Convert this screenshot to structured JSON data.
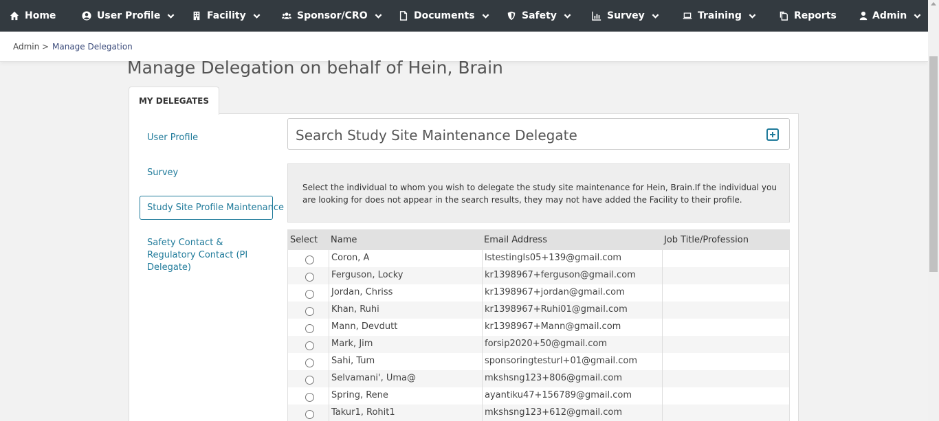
{
  "nav": {
    "home": "Home",
    "user_profile": "User Profile",
    "facility": "Facility",
    "sponsor_cro": "Sponsor/CRO",
    "documents": "Documents",
    "safety": "Safety",
    "survey": "Survey",
    "training": "Training",
    "reports": "Reports",
    "admin": "Admin"
  },
  "breadcrumb": {
    "root": "Admin",
    "separator": ">",
    "current": "Manage Delegation"
  },
  "page": {
    "title": "Manage Delegation on behalf of Hein, Brain",
    "tab": "MY DELEGATES"
  },
  "sidebar": {
    "items": [
      {
        "label": "User Profile"
      },
      {
        "label": "Survey"
      },
      {
        "label": "Study Site Profile Maintenance"
      },
      {
        "label": "Safety Contact & Regulatory Contact (PI Delegate)"
      }
    ]
  },
  "search": {
    "title": "Search Study Site Maintenance Delegate"
  },
  "info": {
    "text": "Select the individual to whom you wish to delegate the study site maintenance for Hein, Brain.If the individual you are looking for does not appear in the search results, they may not have added the Facility to their profile."
  },
  "table": {
    "headers": {
      "select": "Select",
      "name": "Name",
      "email": "Email Address",
      "job": "Job Title/Profession"
    },
    "rows": [
      {
        "name": "Coron, A",
        "email": "lstestingls05+139@gmail.com",
        "job": ""
      },
      {
        "name": "Ferguson, Locky",
        "email": "kr1398967+ferguson@gmail.com",
        "job": ""
      },
      {
        "name": "Jordan, Chriss",
        "email": "kr1398967+jordan@gmail.com",
        "job": ""
      },
      {
        "name": "Khan, Ruhi",
        "email": "kr1398967+Ruhi01@gmail.com",
        "job": ""
      },
      {
        "name": "Mann, Devdutt",
        "email": "kr1398967+Mann@gmail.com",
        "job": ""
      },
      {
        "name": "Mark, Jim",
        "email": "forsip2020+50@gmail.com",
        "job": ""
      },
      {
        "name": "Sahi, Tum",
        "email": "sponsoringtesturl+01@gmail.com",
        "job": ""
      },
      {
        "name": "Selvamani', Uma@",
        "email": "mkshsng123+806@gmail.com",
        "job": ""
      },
      {
        "name": "Spring, Rene",
        "email": "ayantiku47+156789@gmail.com",
        "job": ""
      },
      {
        "name": "Takur1, Rohit1",
        "email": "mkshsng123+612@gmail.com",
        "job": ""
      }
    ]
  }
}
